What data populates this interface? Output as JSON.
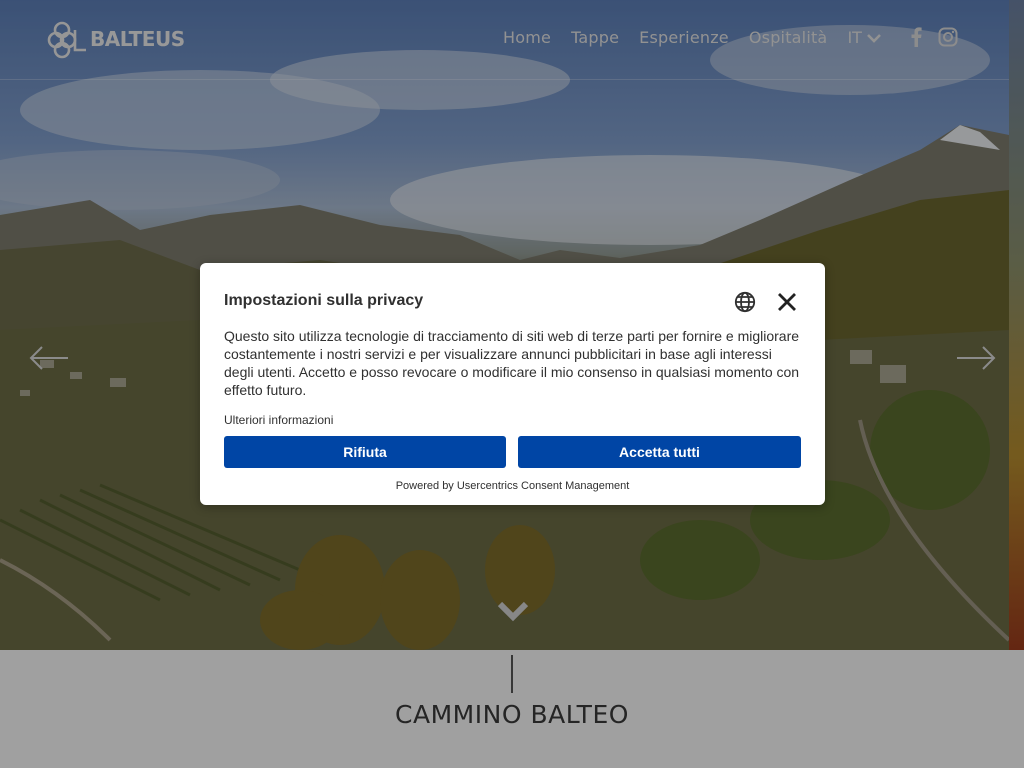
{
  "brand": {
    "name": "BALTEUS"
  },
  "nav": {
    "items": [
      {
        "label": "Home"
      },
      {
        "label": "Tappe"
      },
      {
        "label": "Esperienze"
      },
      {
        "label": "Ospitalità"
      }
    ],
    "language": "IT"
  },
  "social": {
    "icons": [
      "facebook-icon",
      "instagram-icon"
    ]
  },
  "hero": {
    "icons": [
      "arrow-left-icon",
      "arrow-right-icon",
      "chevron-down-icon"
    ]
  },
  "section": {
    "title": "CAMMINO BALTEO"
  },
  "consent": {
    "title": "Impostazioni sulla privacy",
    "body": "Questo sito utilizza tecnologie di tracciamento di siti web di terze parti per fornire e migliorare costantemente i nostri servizi e per visualizzare annunci pubblicitari in base agli interessi degli utenti. Accetto e posso revocare o modificare il mio consenso in qualsiasi momento con effetto futuro.",
    "more_info": "Ulteriori informazioni",
    "deny_label": "Rifiuta",
    "accept_label": "Accetta tutti",
    "powered_by": "Powered by Usercentrics Consent Management",
    "accent_color": "#0045a5"
  }
}
